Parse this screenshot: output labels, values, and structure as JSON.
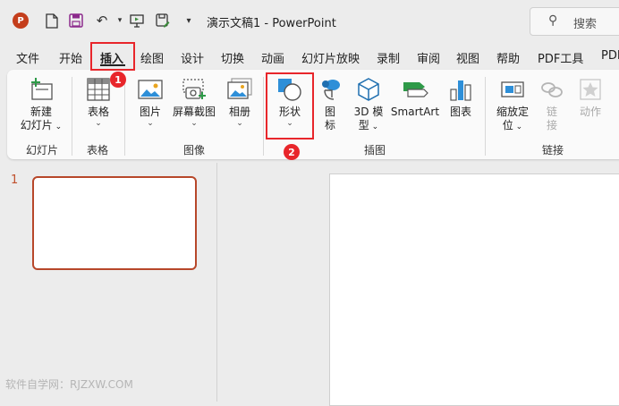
{
  "titlebar": {
    "app_logo_letter": "P",
    "title": "演示文稿1  -  PowerPoint",
    "search_placeholder": "搜索"
  },
  "tabs": [
    "文件",
    "开始",
    "插入",
    "绘图",
    "设计",
    "切换",
    "动画",
    "幻灯片放映",
    "录制",
    "审阅",
    "视图",
    "帮助",
    "PDF工具",
    "PDF"
  ],
  "active_tab": "插入",
  "ribbon": {
    "new_slide": [
      "新建",
      "幻灯片"
    ],
    "table": "表格",
    "picture": "图片",
    "screenshot": "屏幕截图",
    "album": "相册",
    "shape": "形状",
    "icon": [
      "图",
      "标"
    ],
    "model3d": [
      "3D 模",
      "型"
    ],
    "smartart": "SmartArt",
    "chart": "图表",
    "zoom": [
      "缩放定",
      "位"
    ],
    "link": [
      "链",
      "接"
    ],
    "action": "动作"
  },
  "groups": {
    "slides": "幻灯片",
    "tables": "表格",
    "images": "图像",
    "illustrations": "插图",
    "links": "链接"
  },
  "annotations": {
    "badge1": "1",
    "badge2": "2"
  },
  "slides_panel": {
    "slide_number": "1"
  },
  "watermark": "软件自学网：RJZXW.COM",
  "colors": {
    "highlight": "#e8262b",
    "accent": "#b7472a"
  }
}
